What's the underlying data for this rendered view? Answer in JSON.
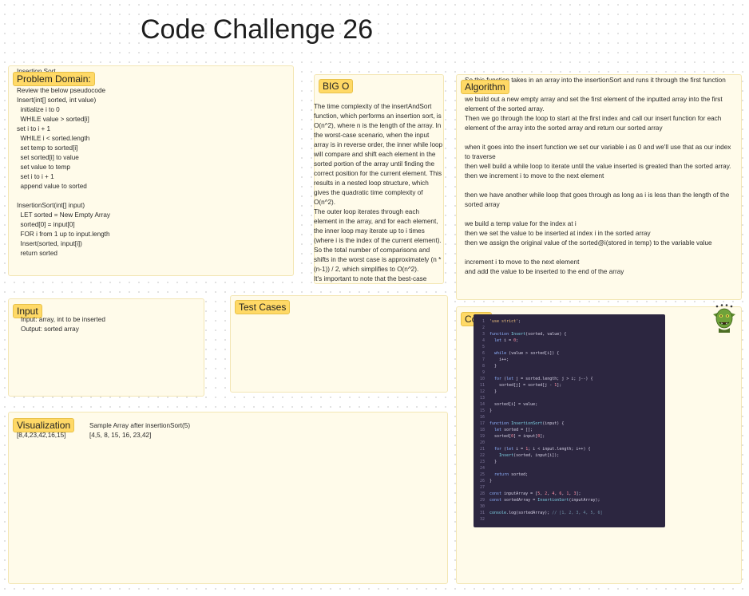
{
  "page_title": "Code Challenge 26",
  "problem_domain": {
    "label": "Problem Domain:",
    "overflow_text": "Insertion Sort",
    "lines": [
      "Review the below pseudocode",
      "Insert(int[] sorted, int value)",
      "  initialize i to 0",
      "  WHILE value > sorted[i]",
      "set i to i + 1",
      "  WHILE i < sorted.length",
      "  set temp to sorted[i]",
      "  set sorted[i] to value",
      "  set value to temp",
      "  set i to i + 1",
      "  append value to sorted",
      "",
      "InsertionSort(int[] input)",
      "  LET sorted = New Empty Array",
      "  sorted[0] = input[0]",
      "  FOR i from 1 up to input.length",
      "  Insert(sorted, input[i])",
      "  return sorted"
    ]
  },
  "big_o": {
    "label": "BIG O",
    "text": "The time complexity of the insertAndSort function, which performs an insertion sort, is O(n^2), where n is the length of the array. In the worst-case scenario, when the input array is in reverse order, the inner while loop will compare and shift each element in the sorted portion of the array until finding the correct position for the current element. This results in a nested loop structure, which gives the quadratic time complexity of O(n^2).\nThe outer loop iterates through each element in the array, and for each element, the inner loop may iterate up to i times (where i is the index of the current element). So the total number of comparisons and shifts in the worst case is approximately (n * (n-1)) / 2, which simplifies to O(n^2).\nIt's important to note that the best-case"
  },
  "algorithm": {
    "label": "Algorithm",
    "overflow_text": "So this function takes in an array into the insertionSort and runs it through the first function",
    "lines": [
      "we build out a new empty array and set the first element of the inputted array into the first",
      "element of the sorted array.",
      "Then we go through the loop to start at the first index and call our insert function for each",
      "element of the array into the sorted array and return our sorted array",
      "",
      "when it goes into the insert function we set our variable i as 0 and we'll use that as our index",
      "to traverse",
      "then well build a while loop to iterate until the value inserted is greated than the sorted array.",
      "then we increment i to move to the next element",
      "",
      "then we have another while loop that goes through as long as i is less than the length of the",
      "sorted array",
      "",
      "we build a temp value for the index at i",
      "then we set the value to be inserted at index i in the sorted array",
      "then we assign the original value of the sorted@i(stored in temp) to the variable value",
      "",
      "increment i to move to the next element",
      "and add the value to be inserted to the end of the array"
    ]
  },
  "input": {
    "label": "Input",
    "lines": [
      "Input: array, int to be inserted",
      "Output: sorted array"
    ]
  },
  "test_cases": {
    "label": "Test Cases"
  },
  "visualization": {
    "label": "Visualization",
    "input_array": "[8,4,23,42,16,15]",
    "sample_heading": "Sample Array after insertionSort(5)",
    "sample_array": "[4,5, 8, 15, 16, 23,42]"
  },
  "code": {
    "label": "Code",
    "avatar_icon": "goblin-avatar-icon",
    "lines": [
      "'use strict';",
      "",
      "function Insert(sorted, value) {",
      "  let i = 0;",
      "",
      "  while (value > sorted[i]) {",
      "    i++;",
      "  }",
      "",
      "  for (let j = sorted.length; j > i; j--) {",
      "    sorted[j] = sorted[j - 1];",
      "  }",
      "",
      "  sorted[i] = value;",
      "}",
      "",
      "function InsertionSort(input) {",
      "  let sorted = [];",
      "  sorted[0] = input[0];",
      "",
      "  for (let i = 1; i < input.length; i++) {",
      "    Insert(sorted, input[i]);",
      "  }",
      "",
      "  return sorted;",
      "}",
      "",
      "const inputArray = [5, 2, 4, 6, 1, 3];",
      "const sortedArray = InsertionSort(inputArray);",
      "",
      "console.log(sortedArray); // [1, 2, 3, 4, 5, 6]",
      ""
    ]
  },
  "colors": {
    "section_bg": "#fffbea",
    "tag_bg": "#ffd966",
    "code_bg": "#2c2640"
  }
}
